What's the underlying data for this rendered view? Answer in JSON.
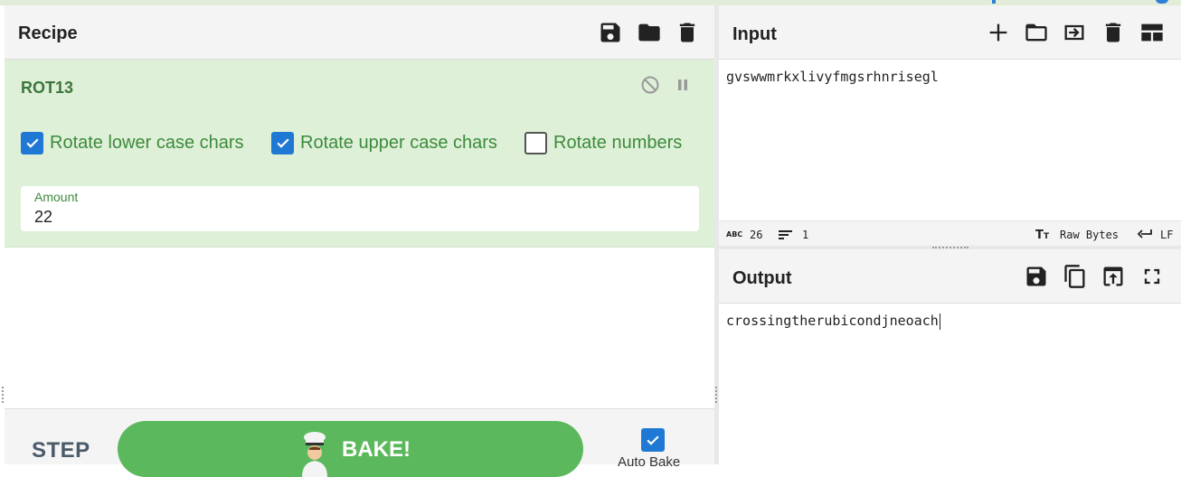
{
  "recipe": {
    "title": "Recipe",
    "icons": [
      "save-icon",
      "folder-icon",
      "trash-icon"
    ]
  },
  "operation": {
    "name": "ROT13",
    "options": {
      "rotate_lower": {
        "label": "Rotate lower case chars",
        "checked": true
      },
      "rotate_upper": {
        "label": "Rotate upper case chars",
        "checked": true
      },
      "rotate_numbers": {
        "label": "Rotate numbers",
        "checked": false
      }
    },
    "amount": {
      "label": "Amount",
      "value": "22"
    }
  },
  "controls": {
    "step_label": "STEP",
    "bake_label": "BAKE!",
    "auto_bake_label": "Auto Bake",
    "auto_bake_checked": true
  },
  "input": {
    "title": "Input",
    "text": "gvswwmrkxlivyfmgsrhnrisegl",
    "stats": {
      "chars": "26",
      "lines": "1",
      "encoding": "Raw Bytes",
      "eol": "LF"
    }
  },
  "output": {
    "title": "Output",
    "text": "crossingtherubicondjneoach"
  },
  "colors": {
    "op_bg": "#dff0d8",
    "op_text": "#3c763d",
    "checkbox": "#1e78d4",
    "bake": "#5cb85c"
  }
}
